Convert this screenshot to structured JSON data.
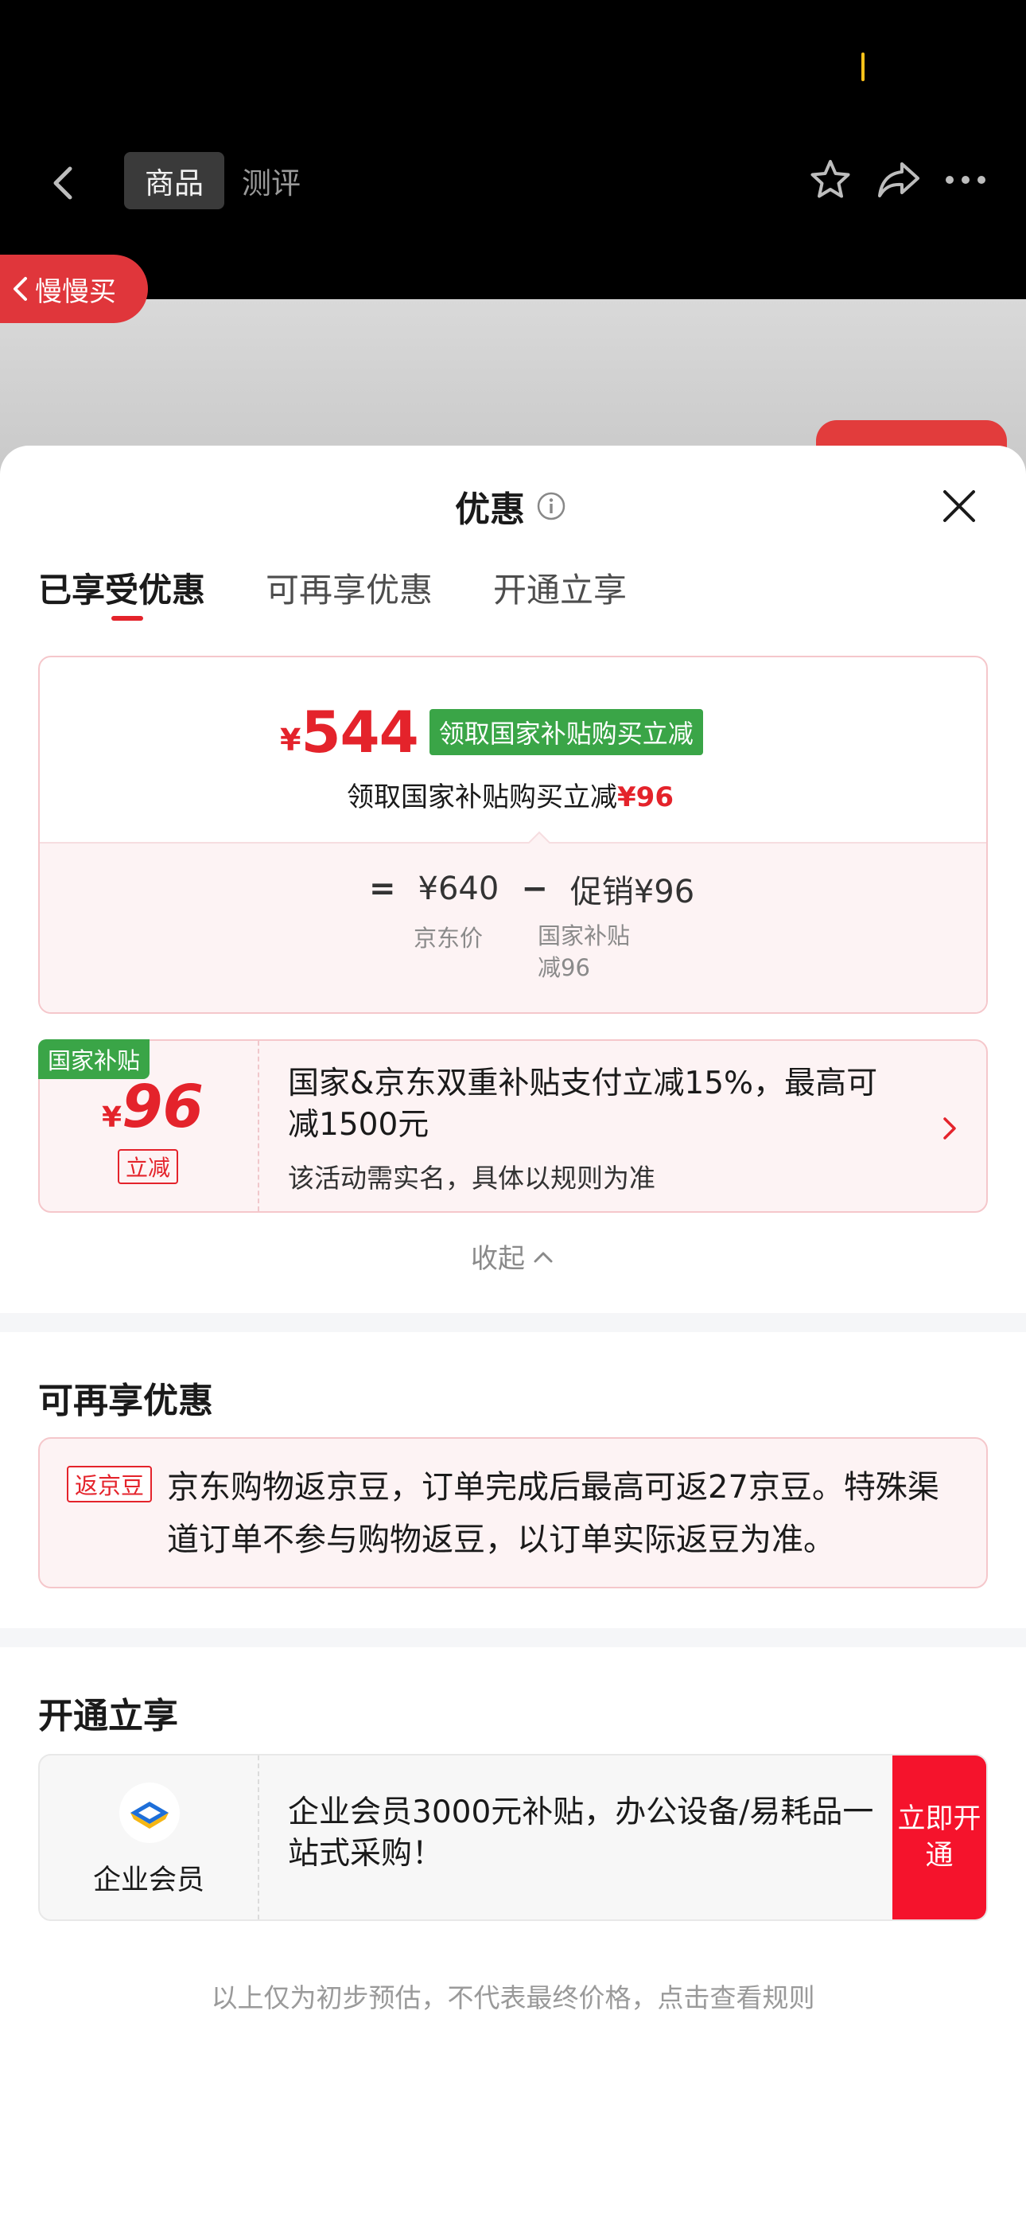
{
  "nav": {
    "tab_product": "商品",
    "tab_review": "测评"
  },
  "slow_buy": {
    "label": "慢慢买"
  },
  "sheet": {
    "title": "优惠",
    "tabs": [
      "已享受优惠",
      "可再享优惠",
      "开通立享"
    ]
  },
  "price_card": {
    "currency": "¥",
    "final_price": "544",
    "subsidy_tag": "领取国家补贴购买立减",
    "subsidy_line_prefix": "领取国家补贴购买立减",
    "subsidy_line_amount": "¥96",
    "calc_equals": "=",
    "calc_base": "¥640",
    "calc_minus": "−",
    "calc_promo": "促销¥96",
    "base_label": "京东价",
    "promo_label": "国家补贴减96"
  },
  "gov_subsidy": {
    "badge": "国家补贴",
    "currency": "¥",
    "amount": "96",
    "tag": "立减",
    "description": "国家&京东双重补贴支付立减15%，最高可减1500元",
    "note": "该活动需实名，具体以规则为准"
  },
  "collapse": {
    "label": "收起"
  },
  "more_offers": {
    "title": "可再享优惠",
    "tag": "返京豆",
    "text": "京东购物返京豆，订单完成后最高可返27京豆。特殊渠道订单不参与购物返豆，以订单实际返豆为准。"
  },
  "open_now": {
    "title": "开通立享",
    "name": "企业会员",
    "text": "企业会员3000元补贴，办公设备/易耗品一站式采购！",
    "button": "立即开通"
  },
  "footer": {
    "note": "以上仅为初步预估，不代表最终价格，点击查看规则"
  },
  "colors": {
    "accent_red": "#e4232b",
    "subsidy_green": "#3aa547",
    "button_red": "#f5132c"
  }
}
